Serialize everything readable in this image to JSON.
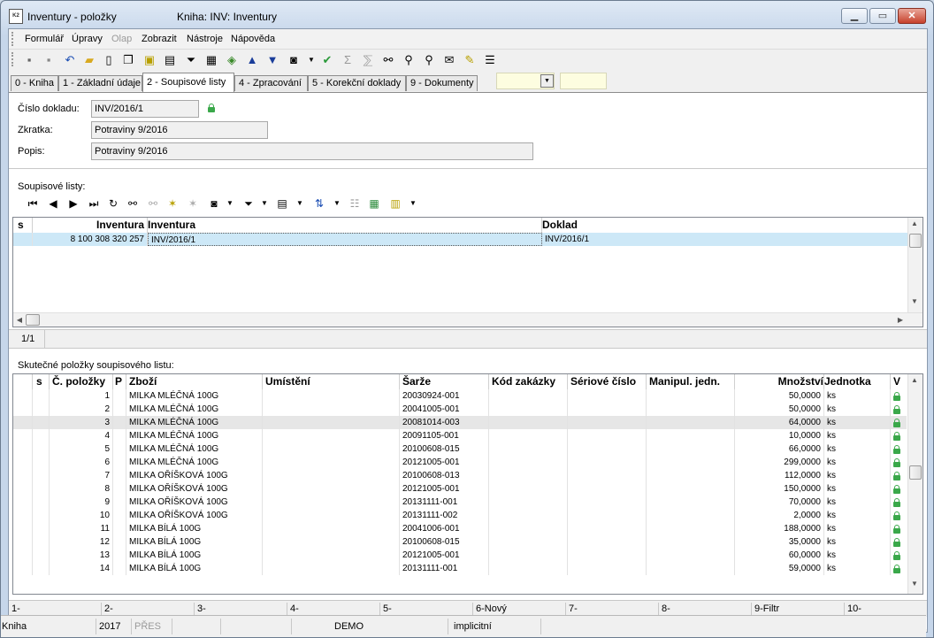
{
  "window": {
    "title": "Inventury - položky",
    "subtitle": "Kniha: INV: Inventury",
    "app_icon_text": "K2"
  },
  "menu": [
    "Formulář",
    "Úpravy",
    "Olap",
    "Zobrazit",
    "Nástroje",
    "Nápověda"
  ],
  "tabs": [
    "0 - Kniha",
    "1 - Základní údaje",
    "2 - Soupisové listy",
    "4 - Zpracování",
    "5 - Korekční doklady",
    "9 - Dokumenty"
  ],
  "form": {
    "cislo_label": "Číslo dokladu:",
    "cislo_value": "INV/2016/1",
    "zkratka_label": "Zkratka:",
    "zkratka_value": "Potraviny 9/2016",
    "popis_label": "Popis:",
    "popis_value": "Potraviny 9/2016"
  },
  "soupisove": {
    "label": "Soupisové listy:",
    "headers": [
      "s",
      "Inventura",
      "Inventura",
      "Doklad"
    ],
    "rows": [
      [
        "",
        "8 100 308 320 257",
        "INV/2016/1",
        "INV/2016/1"
      ]
    ],
    "position": "1/1"
  },
  "polozky": {
    "label": "Skutečné položky soupisového listu:",
    "headers": [
      "s",
      "Č. položky",
      "P",
      "Zboží",
      "Umístění",
      "Šarže",
      "Kód zakázky",
      "Sériové číslo",
      "Manipul. jedn.",
      "Množství",
      "Jednotka",
      "V"
    ],
    "rows": [
      [
        "1",
        "MILKA MLÉČNÁ 100G",
        "20030924-001",
        "50,0000",
        "ks"
      ],
      [
        "2",
        "MILKA MLÉČNÁ 100G",
        "20041005-001",
        "50,0000",
        "ks"
      ],
      [
        "3",
        "MILKA MLÉČNÁ 100G",
        "20081014-003",
        "64,0000",
        "ks"
      ],
      [
        "4",
        "MILKA MLÉČNÁ 100G",
        "20091105-001",
        "10,0000",
        "ks"
      ],
      [
        "5",
        "MILKA MLÉČNÁ 100G",
        "20100608-015",
        "66,0000",
        "ks"
      ],
      [
        "6",
        "MILKA MLÉČNÁ 100G",
        "20121005-001",
        "299,0000",
        "ks"
      ],
      [
        "7",
        "MILKA OŘÍŠKOVÁ 100G",
        "20100608-013",
        "112,0000",
        "ks"
      ],
      [
        "8",
        "MILKA OŘÍŠKOVÁ 100G",
        "20121005-001",
        "150,0000",
        "ks"
      ],
      [
        "9",
        "MILKA OŘÍŠKOVÁ 100G",
        "20131111-001",
        "70,0000",
        "ks"
      ],
      [
        "10",
        "MILKA OŘÍŠKOVÁ 100G",
        "20131111-002",
        "2,0000",
        "ks"
      ],
      [
        "11",
        "MILKA BÍLÁ 100G",
        "20041006-001",
        "188,0000",
        "ks"
      ],
      [
        "12",
        "MILKA BÍLÁ 100G",
        "20100608-015",
        "35,0000",
        "ks"
      ],
      [
        "13",
        "MILKA BÍLÁ 100G",
        "20121005-001",
        "60,0000",
        "ks"
      ],
      [
        "14",
        "MILKA BÍLÁ 100G",
        "20131111-001",
        "59,0000",
        "ks"
      ]
    ]
  },
  "fkeys": [
    "1-",
    "2-",
    "3-",
    "4-",
    "5-",
    "6-Nový",
    "7-",
    "8-",
    "9-Filtr",
    "10-"
  ],
  "status": [
    "Kniha",
    "2017",
    "PŘES",
    "",
    "",
    "DEMO",
    "implicitní",
    ""
  ]
}
